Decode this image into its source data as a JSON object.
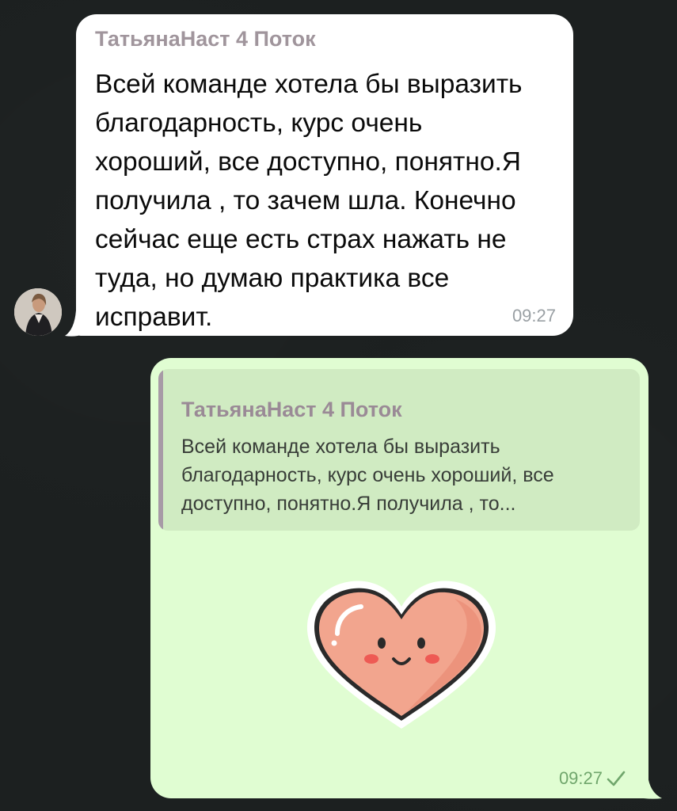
{
  "chat": {
    "incoming": {
      "sender": "ТатьянаНаст 4 Поток",
      "text": "Всей команде хотела бы выразить благодарность, курс очень хороший, все доступно, понятно.Я получила , то зачем шла. Конечно сейчас еще есть страх нажать не туда, но думаю практика все исправит.",
      "time": "09:27"
    },
    "outgoing": {
      "reply_to": {
        "sender": "ТатьянаНаст 4 Поток",
        "text": "Всей команде хотела бы выразить благодарность, курс очень хороший, все доступно, понятно.Я получила , то..."
      },
      "sticker": "smiling-heart-sticker",
      "time": "09:27",
      "status_icon": "single-check-icon"
    }
  },
  "colors": {
    "background": "#1c2020",
    "incoming_bubble": "#ffffff",
    "outgoing_bubble": "#e0fdd2",
    "quote_background": "#d0ebc2",
    "sender_name": "#a0959c",
    "outgoing_time": "#70a66c",
    "heart_fill": "#f2a58e"
  }
}
